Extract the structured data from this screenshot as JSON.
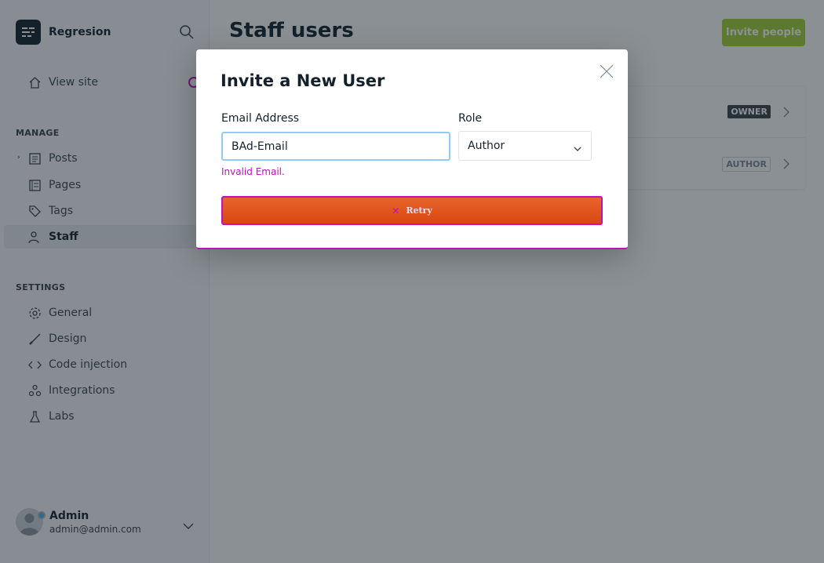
{
  "sidebar": {
    "brand_name": "Regresion",
    "view_site": "View site",
    "manage_title": "MANAGE",
    "manage_items": [
      {
        "label": "Posts",
        "icon": "posts-icon"
      },
      {
        "label": "Pages",
        "icon": "pages-icon"
      },
      {
        "label": "Tags",
        "icon": "tag-icon"
      },
      {
        "label": "Staff",
        "icon": "staff-icon"
      }
    ],
    "settings_title": "SETTINGS",
    "settings_items": [
      {
        "label": "General",
        "icon": "gear-icon"
      },
      {
        "label": "Design",
        "icon": "brush-icon"
      },
      {
        "label": "Code injection",
        "icon": "code-icon"
      },
      {
        "label": "Integrations",
        "icon": "integrations-icon"
      },
      {
        "label": "Labs",
        "icon": "flask-icon"
      }
    ],
    "user": {
      "name": "Admin",
      "email": "admin@admin.com"
    }
  },
  "main": {
    "title": "Staff users",
    "invite_label": "Invite people",
    "staff": [
      {
        "role": "OWNER"
      },
      {
        "role": "AUTHOR"
      }
    ]
  },
  "modal": {
    "title": "Invite a New User",
    "email_label": "Email Address",
    "email_value": "BAd-Email",
    "role_label": "Role",
    "role_value": "Author",
    "error": "Invalid Email.",
    "retry_label": "Retry"
  },
  "colors": {
    "accent_green": "#a4d037",
    "button_orange": "#e05a1e",
    "error_magenta": "#c010c0",
    "focus_blue": "#8fcef2"
  }
}
